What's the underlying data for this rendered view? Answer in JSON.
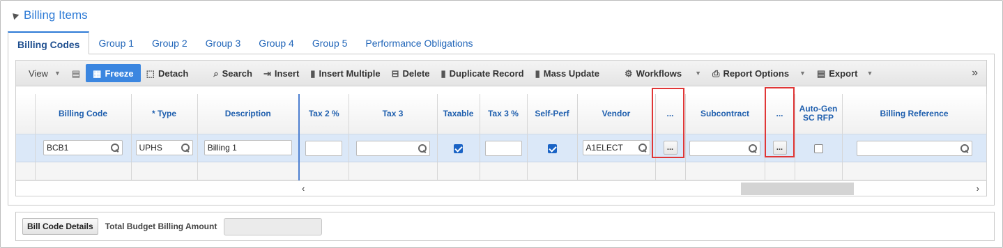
{
  "section": {
    "title": "Billing Items"
  },
  "tabs": [
    {
      "label": "Billing Codes"
    },
    {
      "label": "Group 1"
    },
    {
      "label": "Group 2"
    },
    {
      "label": "Group 3"
    },
    {
      "label": "Group 4"
    },
    {
      "label": "Group 5"
    },
    {
      "label": "Performance Obligations"
    }
  ],
  "toolbar": {
    "view": "View",
    "freeze": "Freeze",
    "detach": "Detach",
    "search": "Search",
    "insert": "Insert",
    "insert_multiple": "Insert Multiple",
    "delete": "Delete",
    "duplicate_record": "Duplicate Record",
    "mass_update": "Mass Update",
    "workflows": "Workflows",
    "report_options": "Report Options",
    "export": "Export",
    "more": "»"
  },
  "columns": [
    "Billing Code",
    "* Type",
    "Description",
    "Tax 2 %",
    "Tax 3",
    "Taxable",
    "Tax 3 %",
    "Self-Perf",
    "Vendor",
    "...",
    "Subcontract",
    "...",
    "Auto-Gen SC RFP",
    "Billing Reference"
  ],
  "row": {
    "billing_code": "BCB1",
    "type": "UPHS",
    "description": "Billing 1",
    "tax2": "",
    "tax3": "",
    "taxable": true,
    "tax3_pct": "",
    "self_perf": true,
    "vendor": "A1ELECT",
    "vendor_ellipsis": "...",
    "subcontract": "",
    "subcontract_ellipsis": "...",
    "auto_gen_sc_rfp": false,
    "billing_reference": ""
  },
  "scroll": {
    "left_arrow": "‹",
    "right_arrow": "›"
  },
  "footer": {
    "bill_code_details": "Bill Code Details",
    "total_budget_label": "Total Budget Billing Amount",
    "total_budget_value": ""
  },
  "colors": {
    "accent": "#2e7bd6",
    "freeze_bg": "#3b86e0",
    "selected_row": "#dbe8f8",
    "highlight_box": "#e03636",
    "header_text": "#1f5fae"
  }
}
